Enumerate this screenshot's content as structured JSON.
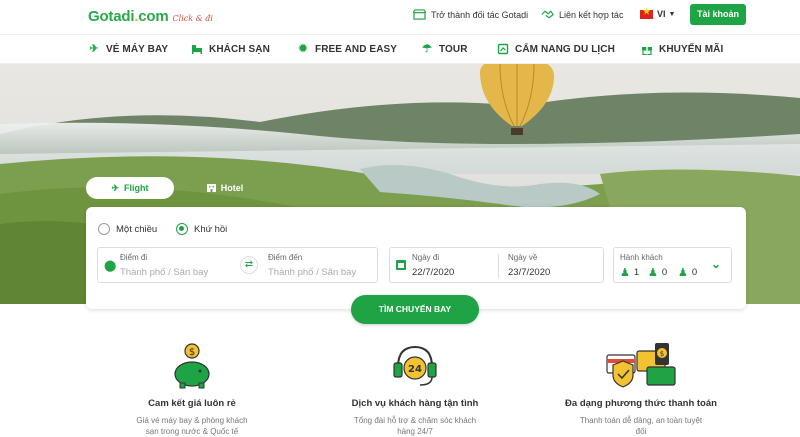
{
  "header": {
    "logo_text": "Gotadi",
    "logo_dot": ".",
    "logo_com": "com",
    "logo_tagline": "Click & đi",
    "partner_link": "Trở thành đối tác Gotadi",
    "cooperation_link": "Liên kết hợp tác",
    "language": "VI",
    "account_button": "Tài khoản"
  },
  "nav": {
    "items": [
      {
        "label": "VÉ MÁY BAY",
        "icon": "plane-icon"
      },
      {
        "label": "KHÁCH SẠN",
        "icon": "bed-icon"
      },
      {
        "label": "FREE AND EASY",
        "icon": "sun-icon"
      },
      {
        "label": "TOUR",
        "icon": "umbrella-icon"
      },
      {
        "label": "CẨM NANG DU LỊCH",
        "icon": "book-icon"
      },
      {
        "label": "KHUYẾN MÃI",
        "icon": "gift-icon"
      }
    ]
  },
  "search": {
    "tabs": [
      {
        "label": "Flight",
        "active": true
      },
      {
        "label": "Hotel",
        "active": false
      }
    ],
    "trip_types": [
      {
        "label": "Một chiều",
        "selected": false
      },
      {
        "label": "Khứ hồi",
        "selected": true
      }
    ],
    "origin": {
      "label": "Điểm đi",
      "placeholder": "Thành phố / Sân bay"
    },
    "destination": {
      "label": "Điểm đến",
      "placeholder": "Thành phố / Sân bay"
    },
    "depart": {
      "label": "Ngày đi",
      "value": "22/7/2020"
    },
    "return": {
      "label": "Ngày về",
      "value": "23/7/2020"
    },
    "passengers": {
      "label": "Hành khách",
      "adults": "1",
      "children": "0",
      "infants": "0"
    },
    "submit_label": "TÌM CHUYẾN BAY"
  },
  "features": [
    {
      "title": "Cam kết giá luôn rẻ",
      "desc": "Giá vé máy bay & phòng khách sạn trong nước & Quốc tế",
      "icon": "piggy-bank-icon"
    },
    {
      "title": "Dịch vụ khách hàng tận tình",
      "desc": "Tổng đài hỗ trợ & chăm sóc khách hàng 24/7",
      "icon": "headset-24-icon"
    },
    {
      "title": "Đa dạng phương thức thanh toán",
      "desc": "Thanh toán dễ dàng, an toàn tuyệt đối",
      "icon": "payment-methods-icon"
    }
  ],
  "colors": {
    "brand": "#1ea345",
    "tagline": "#e24b3b"
  }
}
